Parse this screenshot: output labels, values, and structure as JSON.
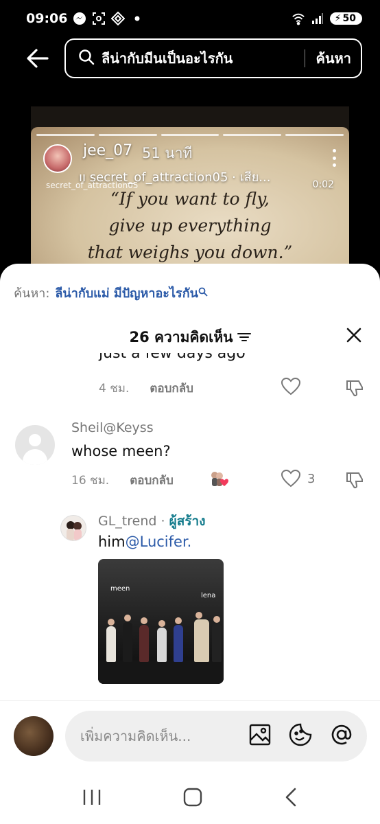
{
  "status_bar": {
    "time": "09:06",
    "battery": "50"
  },
  "top_search": {
    "query": "ลีน่ากับมีนเป็นอะไรกัน",
    "button": "ค้นหา"
  },
  "story": {
    "username": "jee_07",
    "time_ago": "51 นาที",
    "audio": "secret_of_attraction05 · เสีย...",
    "watermark": "secret_of_attraction05",
    "duration": "0:02",
    "quote_lines": [
      "“If you want to fly,",
      "give up everything",
      "that weighs you down.”"
    ]
  },
  "sheet": {
    "search_label": "ค้นหา:",
    "search_query": "ลีน่ากับแม่ มีปัญหาอะไรกัน",
    "title": "26 ความคิดเห็น"
  },
  "comments": {
    "partial": {
      "text": "just a few days ago",
      "time": "4 ชม.",
      "reply": "ตอบกลับ"
    },
    "c1": {
      "user": "Sheil@Keyss",
      "text": "whose meen?",
      "time": "16 ชม.",
      "reply": "ตอบกลับ",
      "likes": "3"
    },
    "c2": {
      "user": "GL_trend",
      "creator": "ผู้สร้าง",
      "text_prefix": "him",
      "mention": "@Lucifer.",
      "photo_label_left": "meen",
      "photo_label_right": "lena"
    }
  },
  "input": {
    "placeholder": "เพิ่มความคิดเห็น..."
  },
  "colors": {
    "mention": "#2b5aa8",
    "creator": "#137b8c",
    "sheet_bg": "#ffffff",
    "top_bg": "#000000"
  }
}
